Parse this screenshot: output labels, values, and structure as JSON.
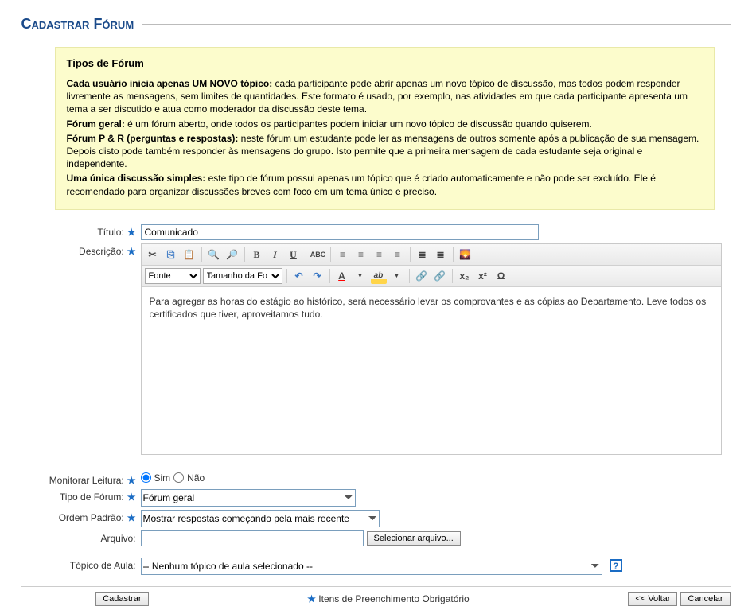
{
  "page": {
    "title": "Cadastrar Fórum"
  },
  "info": {
    "heading": "Tipos de Fórum",
    "p1_b": "Cada usuário inicia apenas UM NOVO tópico:",
    "p1": " cada participante pode abrir apenas um novo tópico de discussão, mas todos podem responder livremente as mensagens, sem limites de quantidades. Este formato é usado, por exemplo, nas atividades em que cada participante apresenta um tema a ser discutido e atua como moderador da discussão deste tema.",
    "p2_b": "Fórum geral:",
    "p2": " é um fórum aberto, onde todos os participantes podem iniciar um novo tópico de discussão quando quiserem.",
    "p3_b": "Fórum P & R (perguntas e respostas):",
    "p3": " neste fórum um estudante pode ler as mensagens de outros somente após a publicação de sua mensagem. Depois disto pode também responder às mensagens do grupo. Isto permite que a primeira mensagem de cada estudante seja original e independente.",
    "p4_b": "Uma única discussão simples:",
    "p4": " este tipo de fórum possui apenas um tópico que é criado automaticamente e não pode ser excluído. Ele é recomendado para organizar discussões breves com foco em um tema único e preciso."
  },
  "labels": {
    "titulo": "Título:",
    "descricao": "Descrição:",
    "monitorar": "Monitorar Leitura:",
    "tipo": "Tipo de Fórum:",
    "ordem": "Ordem Padrão:",
    "arquivo": "Arquivo:",
    "topico": "Tópico de Aula:"
  },
  "form": {
    "titulo_value": "Comunicado",
    "descricao_value": "Para agregar as horas do estágio ao histórico, será necessário levar os comprovantes e as cópias ao Departamento. Leve todos os certificados que tiver, aproveitamos tudo.",
    "sim": "Sim",
    "nao": "Não",
    "tipo_selected": "Fórum geral",
    "ordem_selected": "Mostrar respostas começando pela mais recente",
    "selecionar_arquivo": "Selecionar arquivo...",
    "topico_selected": "-- Nenhum tópico de aula selecionado --",
    "help": "?"
  },
  "editor": {
    "font_label": "Fonte",
    "size_label": "Tamanho da Fo",
    "icons": {
      "b": "B",
      "i": "I",
      "u": "U",
      "abc": "ABC",
      "x2": "x₂",
      "x2u": "x²",
      "omega": "Ω"
    }
  },
  "footer": {
    "cadastrar": "Cadastrar",
    "obrig": " Itens de Preenchimento Obrigatório",
    "voltar": "<< Voltar",
    "cancelar": "Cancelar"
  }
}
